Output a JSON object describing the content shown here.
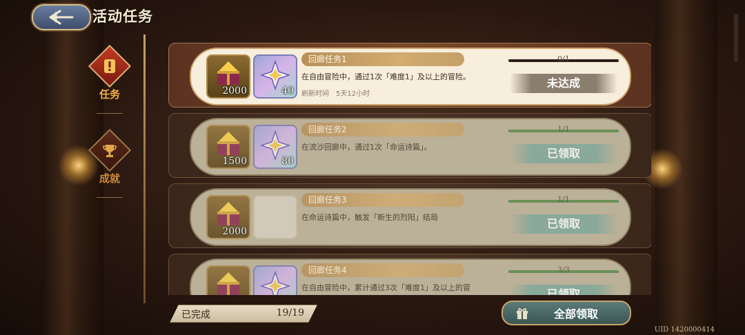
{
  "header": {
    "title": "活动任务",
    "back_icon": "back-arrow-icon"
  },
  "sidebar": {
    "items": [
      {
        "label": "任务",
        "icon": "exclamation-icon",
        "active": true
      },
      {
        "label": "成就",
        "icon": "trophy-icon",
        "active": false
      }
    ]
  },
  "quests": [
    {
      "name": "回廊任务1",
      "description": "在自由冒险中，通过1次「难度1」及以上的冒险。",
      "refresh_label": "刷新时间",
      "refresh_value": "5天12小时",
      "progress_text": "0/1",
      "progress_fraction": 0,
      "status": "未达成",
      "rewards": [
        {
          "icon": "gold-chest-icon",
          "count": "2000"
        },
        {
          "icon": "star-crystal-icon",
          "count": "40"
        }
      ]
    },
    {
      "name": "回廊任务2",
      "description": "在流沙回廊中，通过1次「命运诗篇」。",
      "progress_text": "1/1",
      "progress_fraction": 1,
      "status": "已领取",
      "rewards": [
        {
          "icon": "gold-chest-icon",
          "count": "1500"
        },
        {
          "icon": "star-crystal-icon",
          "count": "80"
        }
      ]
    },
    {
      "name": "回廊任务3",
      "description": "在命运诗篇中，触发「新生的烈阳」结局",
      "progress_text": "1/1",
      "progress_fraction": 1,
      "status": "已领取",
      "rewards": [
        {
          "icon": "gold-chest-icon",
          "count": "2000"
        }
      ]
    },
    {
      "name": "回廊任务4",
      "description": "在自由冒险中，累计通过3次「难度1」及以上的冒",
      "progress_text": "3/3",
      "progress_fraction": 1,
      "status": "已领取",
      "rewards": [
        {
          "icon": "gold-chest-icon",
          "count": ""
        },
        {
          "icon": "star-crystal-icon",
          "count": ""
        }
      ]
    }
  ],
  "footer": {
    "completed_label": "已完成",
    "completed_value": "19/19",
    "claim_all_label": "全部领取",
    "uid": "UID 1420000414"
  },
  "colors": {
    "active_tab": "#f5b04a",
    "claimed": "#7fa89c",
    "pending": "#8a7e6e",
    "progress": "#5a8a4a"
  }
}
